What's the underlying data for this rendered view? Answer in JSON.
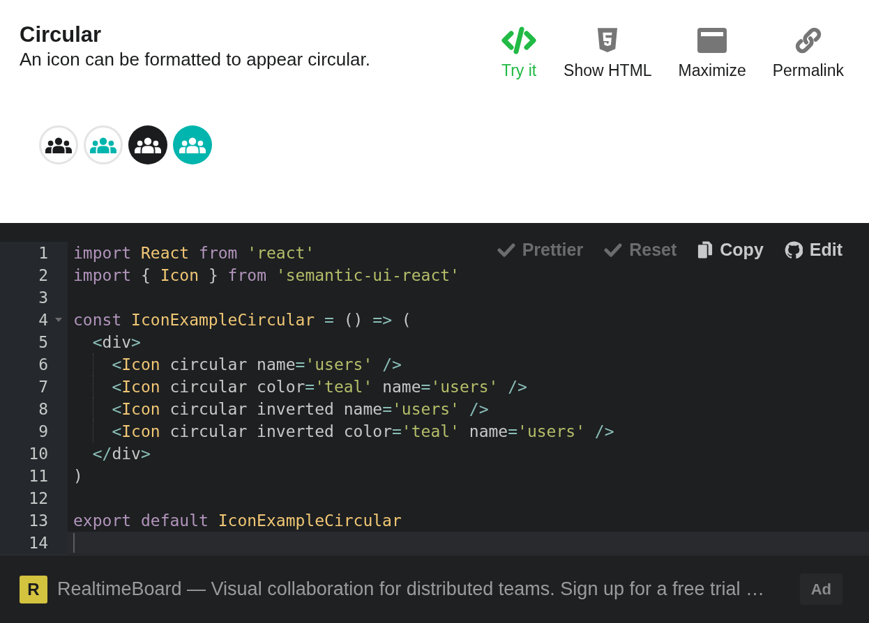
{
  "header": {
    "title": "Circular",
    "description": "An icon can be formatted to appear circular."
  },
  "actions": [
    {
      "label": "Try it",
      "active": true
    },
    {
      "label": "Show HTML",
      "active": false
    },
    {
      "label": "Maximize",
      "active": false
    },
    {
      "label": "Permalink",
      "active": false
    }
  ],
  "examples": [
    {
      "inverted": false,
      "color": "#1b1c1d"
    },
    {
      "inverted": false,
      "color": "#00b5ad"
    },
    {
      "inverted": true,
      "color": "#1b1c1d"
    },
    {
      "inverted": true,
      "color": "#00b5ad"
    }
  ],
  "editor": {
    "toolbar": [
      {
        "label": "Prettier",
        "disabled": true
      },
      {
        "label": "Reset",
        "disabled": true
      },
      {
        "label": "Copy",
        "disabled": false
      },
      {
        "label": "Edit",
        "disabled": false
      }
    ],
    "lines": [
      {
        "number": "1",
        "fold": false,
        "guide": false,
        "active": false,
        "tokens": [
          {
            "kind": "kw",
            "text": "import"
          },
          {
            "kind": "id",
            "text": " React"
          },
          {
            "kind": "kw",
            "text": " from"
          },
          {
            "kind": "str",
            "text": " 'react'"
          }
        ]
      },
      {
        "number": "2",
        "fold": false,
        "guide": false,
        "active": false,
        "tokens": [
          {
            "kind": "kw",
            "text": "import"
          },
          {
            "kind": "plain",
            "text": " {"
          },
          {
            "kind": "id",
            "text": " Icon"
          },
          {
            "kind": "plain",
            "text": " }"
          },
          {
            "kind": "kw",
            "text": " from"
          },
          {
            "kind": "str",
            "text": " 'semantic-ui-react'"
          }
        ]
      },
      {
        "number": "3",
        "fold": false,
        "guide": false,
        "active": false
      },
      {
        "number": "4",
        "fold": true,
        "guide": false,
        "active": false,
        "tokens": [
          {
            "kind": "kw",
            "text": "const"
          },
          {
            "kind": "id",
            "text": " IconExampleCircular"
          },
          {
            "kind": "op",
            "text": " ="
          },
          {
            "kind": "plain",
            "text": " ()"
          },
          {
            "kind": "op",
            "text": " =>"
          },
          {
            "kind": "plain",
            "text": " ("
          }
        ]
      },
      {
        "number": "5",
        "fold": false,
        "guide": false,
        "active": false,
        "tokens": [
          {
            "kind": "op",
            "text": "  <"
          },
          {
            "kind": "plain",
            "text": "div"
          },
          {
            "kind": "op",
            "text": ">"
          }
        ]
      },
      {
        "number": "6",
        "fold": false,
        "guide": true,
        "active": false,
        "tokens": [
          {
            "kind": "op",
            "text": "    <"
          },
          {
            "kind": "id",
            "text": "Icon"
          },
          {
            "kind": "plain",
            "text": " circular name"
          },
          {
            "kind": "op",
            "text": "="
          },
          {
            "kind": "str",
            "text": "'users'"
          },
          {
            "kind": "op",
            "text": " />"
          }
        ]
      },
      {
        "number": "7",
        "fold": false,
        "guide": true,
        "active": false,
        "tokens": [
          {
            "kind": "op",
            "text": "    <"
          },
          {
            "kind": "id",
            "text": "Icon"
          },
          {
            "kind": "plain",
            "text": " circular color"
          },
          {
            "kind": "op",
            "text": "="
          },
          {
            "kind": "str",
            "text": "'teal'"
          },
          {
            "kind": "plain",
            "text": " name"
          },
          {
            "kind": "op",
            "text": "="
          },
          {
            "kind": "str",
            "text": "'users'"
          },
          {
            "kind": "op",
            "text": " />"
          }
        ]
      },
      {
        "number": "8",
        "fold": false,
        "guide": true,
        "active": false,
        "tokens": [
          {
            "kind": "op",
            "text": "    <"
          },
          {
            "kind": "id",
            "text": "Icon"
          },
          {
            "kind": "plain",
            "text": " circular inverted name"
          },
          {
            "kind": "op",
            "text": "="
          },
          {
            "kind": "str",
            "text": "'users'"
          },
          {
            "kind": "op",
            "text": " />"
          }
        ]
      },
      {
        "number": "9",
        "fold": false,
        "guide": true,
        "active": false,
        "tokens": [
          {
            "kind": "op",
            "text": "    <"
          },
          {
            "kind": "id",
            "text": "Icon"
          },
          {
            "kind": "plain",
            "text": " circular inverted color"
          },
          {
            "kind": "op",
            "text": "="
          },
          {
            "kind": "str",
            "text": "'teal'"
          },
          {
            "kind": "plain",
            "text": " name"
          },
          {
            "kind": "op",
            "text": "="
          },
          {
            "kind": "str",
            "text": "'users'"
          },
          {
            "kind": "op",
            "text": " />"
          }
        ]
      },
      {
        "number": "10",
        "fold": false,
        "guide": false,
        "active": false,
        "tokens": [
          {
            "kind": "op",
            "text": "  </"
          },
          {
            "kind": "plain",
            "text": "div"
          },
          {
            "kind": "op",
            "text": ">"
          }
        ]
      },
      {
        "number": "11",
        "fold": false,
        "guide": false,
        "active": false,
        "tokens": [
          {
            "kind": "plain",
            "text": ")"
          }
        ]
      },
      {
        "number": "12",
        "fold": false,
        "guide": false,
        "active": false
      },
      {
        "number": "13",
        "fold": false,
        "guide": false,
        "active": false,
        "tokens": [
          {
            "kind": "kw",
            "text": "export"
          },
          {
            "kind": "kw",
            "text": " default"
          },
          {
            "kind": "id",
            "text": " IconExampleCircular"
          }
        ]
      },
      {
        "number": "14",
        "fold": false,
        "guide": false,
        "active": true
      }
    ]
  },
  "ad": {
    "logo": "R",
    "text": "RealtimeBoard — Visual collaboration for distributed teams. Sign up for a free trial …",
    "badge": "Ad"
  }
}
